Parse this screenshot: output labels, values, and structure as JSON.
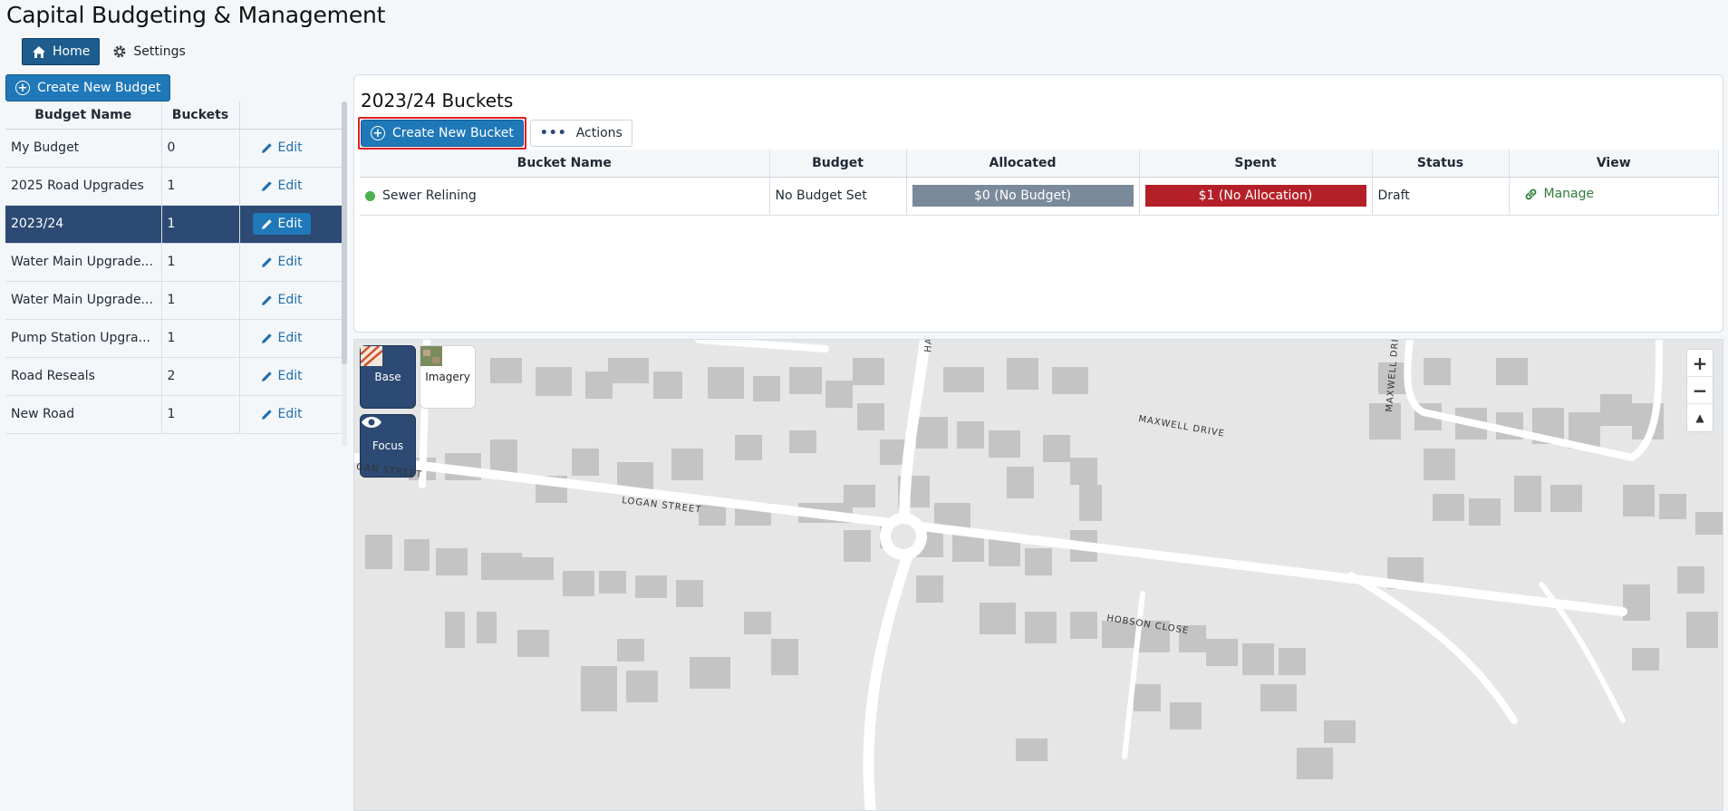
{
  "app": {
    "title": "Capital Budgeting & Management"
  },
  "nav": {
    "home_label": "Home",
    "settings_label": "Settings"
  },
  "sidebar": {
    "create_label": "Create New Budget",
    "columns": [
      "Budget Name",
      "Buckets"
    ],
    "edit_label": "Edit",
    "rows": [
      {
        "name": "My Budget",
        "buckets": "0"
      },
      {
        "name": "2025 Road Upgrades",
        "buckets": "1"
      },
      {
        "name": "2023/24",
        "buckets": "1"
      },
      {
        "name": "Water Main Upgrade...",
        "buckets": "1"
      },
      {
        "name": "Water Main Upgrade...",
        "buckets": "1"
      },
      {
        "name": "Pump Station Upgra...",
        "buckets": "1"
      },
      {
        "name": "Road Reseals",
        "buckets": "2"
      },
      {
        "name": "New Road",
        "buckets": "1"
      }
    ],
    "selected_index": 2
  },
  "panel": {
    "title": "2023/24 Buckets",
    "create_label": "Create New Bucket",
    "actions_label": "Actions",
    "columns": [
      "Bucket Name",
      "Budget",
      "Allocated",
      "Spent",
      "Status",
      "View"
    ],
    "rows": [
      {
        "name": "Sewer Relining",
        "budget": "No Budget Set",
        "allocated": "$0 (No Budget)",
        "spent": "$1 (No Allocation)",
        "status": "Draft",
        "view": "Manage"
      }
    ]
  },
  "map": {
    "base_label": "Base",
    "imagery_label": "Imagery",
    "focus_label": "Focus",
    "zoom_in": "+",
    "zoom_out": "−",
    "reset": "▲",
    "streets": [
      "GAN STREET",
      "LOGAN STREET",
      "MAXWELL DRIVE",
      "HOBSON CLOSE",
      "MAXWELL DRI",
      "HA"
    ]
  },
  "colors": {
    "primary": "#1f78b8",
    "selected": "#2c4a73",
    "danger": "#b52028",
    "muted": "#7a8a9a",
    "success": "#4caf50"
  }
}
